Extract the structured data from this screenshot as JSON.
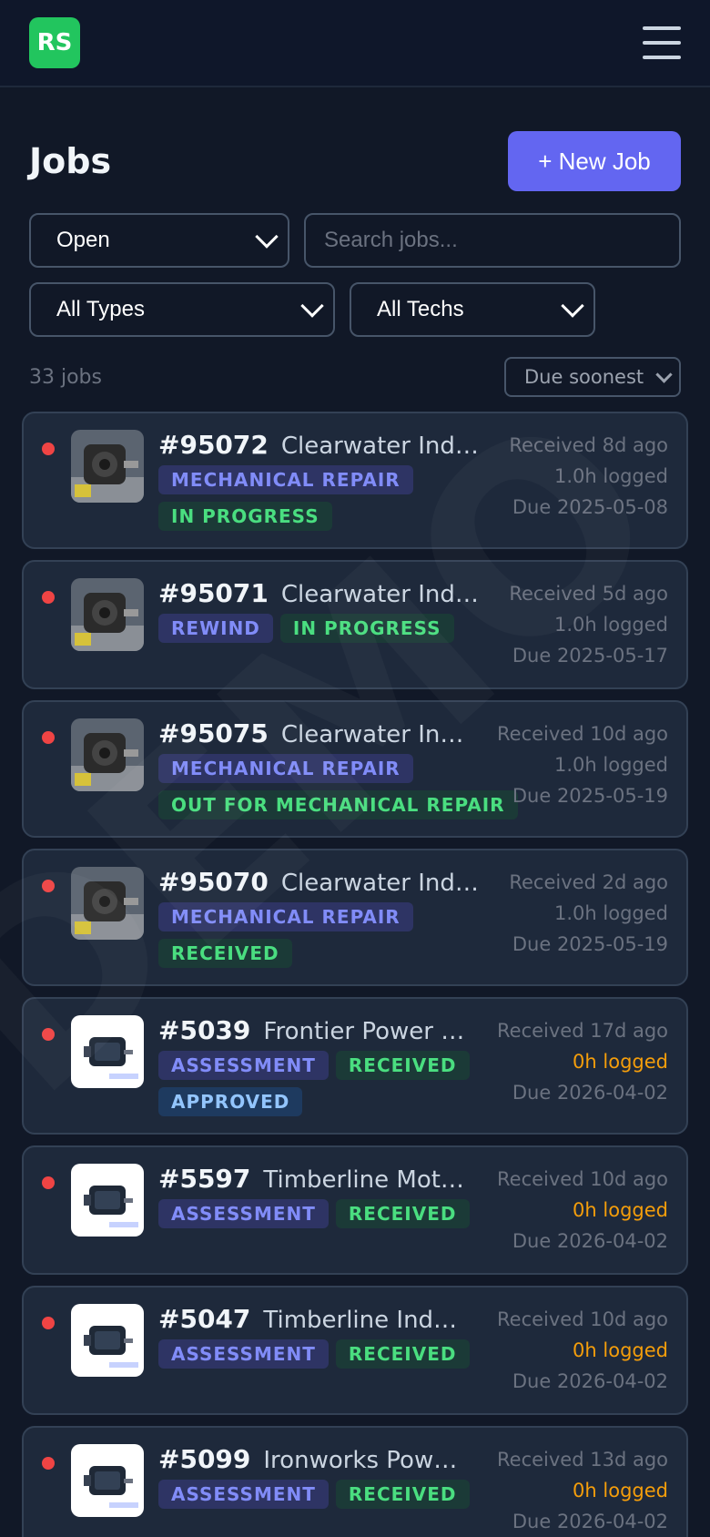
{
  "app": {
    "logo_text": "RS"
  },
  "header": {
    "title": "Jobs",
    "new_job_label": "+ New Job"
  },
  "filters": {
    "status": "Open",
    "search_placeholder": "Search jobs...",
    "type": "All Types",
    "tech": "All Techs"
  },
  "summary": {
    "count_label": "33 jobs",
    "sort": "Due soonest"
  },
  "watermark": "DEMO",
  "jobs": [
    {
      "number": "#95072",
      "customer": "Clearwater Ind…",
      "badges": [
        {
          "text": "MECHANICAL REPAIR",
          "kind": "type"
        },
        {
          "text": "IN PROGRESS",
          "kind": "status"
        }
      ],
      "received": "Received 8d ago",
      "logged": "1.0h logged",
      "due": "Due 2025-05-08",
      "photo": "motor-photo"
    },
    {
      "number": "#95071",
      "customer": "Clearwater Ind…",
      "badges": [
        {
          "text": "REWIND",
          "kind": "type"
        },
        {
          "text": "IN PROGRESS",
          "kind": "status"
        }
      ],
      "received": "Received 5d ago",
      "logged": "1.0h logged",
      "due": "Due 2025-05-17",
      "photo": "motor-photo"
    },
    {
      "number": "#95075",
      "customer": "Clearwater In…",
      "badges": [
        {
          "text": "MECHANICAL REPAIR",
          "kind": "type"
        },
        {
          "text": "OUT FOR MECHANICAL REPAIR",
          "kind": "status"
        }
      ],
      "received": "Received 10d ago",
      "logged": "1.0h logged",
      "due": "Due 2025-05-19",
      "photo": "motor-photo"
    },
    {
      "number": "#95070",
      "customer": "Clearwater Ind…",
      "badges": [
        {
          "text": "MECHANICAL REPAIR",
          "kind": "type"
        },
        {
          "text": "RECEIVED",
          "kind": "status"
        }
      ],
      "received": "Received 2d ago",
      "logged": "1.0h logged",
      "due": "Due 2025-05-19",
      "photo": "motor-photo"
    },
    {
      "number": "#5039",
      "customer": "Frontier Power …",
      "badges": [
        {
          "text": "ASSESSMENT",
          "kind": "type"
        },
        {
          "text": "RECEIVED",
          "kind": "status"
        },
        {
          "text": "APPROVED",
          "kind": "approved"
        }
      ],
      "received": "Received 17d ago",
      "logged": "0h logged",
      "due": "Due 2026-04-02",
      "photo": "product-photo"
    },
    {
      "number": "#5597",
      "customer": "Timberline Mot…",
      "badges": [
        {
          "text": "ASSESSMENT",
          "kind": "type"
        },
        {
          "text": "RECEIVED",
          "kind": "status"
        }
      ],
      "received": "Received 10d ago",
      "logged": "0h logged",
      "due": "Due 2026-04-02",
      "photo": "product-photo"
    },
    {
      "number": "#5047",
      "customer": "Timberline Ind…",
      "badges": [
        {
          "text": "ASSESSMENT",
          "kind": "type"
        },
        {
          "text": "RECEIVED",
          "kind": "status"
        }
      ],
      "received": "Received 10d ago",
      "logged": "0h logged",
      "due": "Due 2026-04-02",
      "photo": "product-photo"
    },
    {
      "number": "#5099",
      "customer": "Ironworks Pow…",
      "badges": [
        {
          "text": "ASSESSMENT",
          "kind": "type"
        },
        {
          "text": "RECEIVED",
          "kind": "status"
        }
      ],
      "received": "Received 13d ago",
      "logged": "0h logged",
      "due": "Due 2026-04-02",
      "photo": "product-photo"
    }
  ]
}
